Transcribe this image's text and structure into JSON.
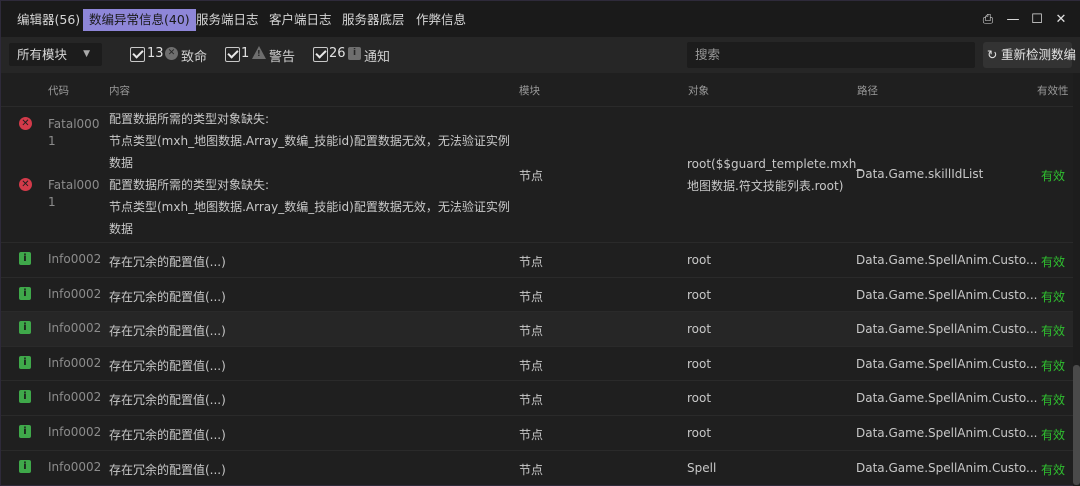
{
  "tabs": [
    {
      "label": "编辑器(56)"
    },
    {
      "label": "数编异常信息(40)"
    },
    {
      "label": "服务端日志"
    },
    {
      "label": "客户端日志"
    },
    {
      "label": "服务器底层"
    },
    {
      "label": "作弊信息"
    }
  ],
  "window_buttons": {
    "print": "⎙",
    "minimize": "—",
    "maximize": "☐",
    "close": "✕"
  },
  "filters": {
    "module_select": "所有模块",
    "fatal": {
      "count": "13",
      "label": "致命"
    },
    "warning": {
      "count": "1",
      "label": "警告"
    },
    "info": {
      "count": "26",
      "label": "通知"
    },
    "search_placeholder": "搜索",
    "recheck_label": "重新检测数编"
  },
  "columns": {
    "code": "代码",
    "content": "内容",
    "module": "模块",
    "object": "对象",
    "path": "路径",
    "validity": "有效性"
  },
  "fatal_group": {
    "entries": [
      {
        "code_line1": "Fatal000",
        "code_line2": "1"
      },
      {
        "code_line1": "Fatal000",
        "code_line2": "1"
      }
    ],
    "content_lines": [
      "配置数据所需的类型对象缺失:",
      "节点类型(mxh_地图数据.Array_数编_技能id)配置数据无效，无法验证实例",
      "数据",
      "配置数据所需的类型对象缺失:",
      "节点类型(mxh_地图数据.Array_数编_技能id)配置数据无效，无法验证实例",
      "数据"
    ],
    "module": "节点",
    "object_line1": "root($$guard_templete.mxh_",
    "object_line2": "地图数据.符文技能列表.root)",
    "path": "Data.Game.skillIdList",
    "validity": "有效"
  },
  "rows": [
    {
      "code": "Info0002",
      "content": "存在冗余的配置值(...)",
      "module": "节点",
      "object": "root",
      "path": "Data.Game.SpellAnim.Custo...",
      "validity": "有效"
    },
    {
      "code": "Info0002",
      "content": "存在冗余的配置值(...)",
      "module": "节点",
      "object": "root",
      "path": "Data.Game.SpellAnim.Custo...",
      "validity": "有效"
    },
    {
      "code": "Info0002",
      "content": "存在冗余的配置值(...)",
      "module": "节点",
      "object": "root",
      "path": "Data.Game.SpellAnim.Custo...",
      "validity": "有效"
    },
    {
      "code": "Info0002",
      "content": "存在冗余的配置值(...)",
      "module": "节点",
      "object": "root",
      "path": "Data.Game.SpellAnim.Custo...",
      "validity": "有效"
    },
    {
      "code": "Info0002",
      "content": "存在冗余的配置值(...)",
      "module": "节点",
      "object": "root",
      "path": "Data.Game.SpellAnim.Custo...",
      "validity": "有效"
    },
    {
      "code": "Info0002",
      "content": "存在冗余的配置值(...)",
      "module": "节点",
      "object": "root",
      "path": "Data.Game.SpellAnim.Custo...",
      "validity": "有效"
    },
    {
      "code": "Info0002",
      "content": "存在冗余的配置值(...)",
      "module": "节点",
      "object": "Spell",
      "path": "Data.Game.SpellAnim.Custo...",
      "validity": "有效"
    }
  ]
}
